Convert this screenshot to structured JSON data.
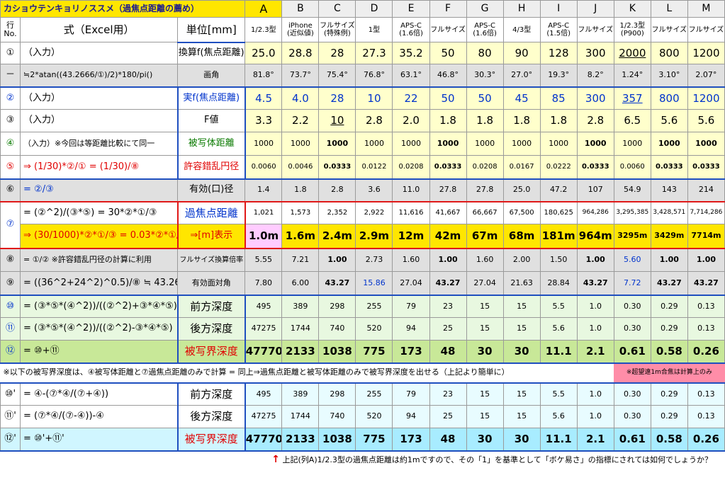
{
  "title": "カショウテンキョリノススメ（過焦点距離の薦め）",
  "columns": [
    "A",
    "B",
    "C",
    "D",
    "E",
    "F",
    "G",
    "H",
    "I",
    "J",
    "K",
    "L",
    "M"
  ],
  "header2": {
    "row_no": "行\nNo.",
    "formula": "式（Excel用）",
    "unit": "単位[mm]",
    "subs": [
      "1/2.3型",
      "iPhone\n(近似値)",
      "フルサイズ\n(特殊例)",
      "1型",
      "APS-C\n(1.6倍)",
      "フルサイズ",
      "APS-C\n(1.6倍)",
      "4/3型",
      "APS-C\n(1.5倍)",
      "フルサイズ",
      "1/2.3型\n(P900)",
      "フルサイズ",
      "フルサイズ"
    ]
  },
  "rows": [
    {
      "idx": "①",
      "formula": "（入力）",
      "unit": "換算f(焦点距離)",
      "values": [
        "25.0",
        "28.8",
        "28",
        "27.3",
        "35.2",
        "50",
        "80",
        "90",
        "128",
        "300",
        "2000",
        "800",
        "1200"
      ]
    },
    {
      "idx": "－",
      "formula": "≒2*atan((43.2666/①)/2)*180/pi()",
      "unit": "画角",
      "values": [
        "81.8°",
        "73.7°",
        "75.4°",
        "76.8°",
        "63.1°",
        "46.8°",
        "30.3°",
        "27.0°",
        "19.3°",
        "8.2°",
        "1.24°",
        "3.10°",
        "2.07°"
      ]
    },
    {
      "idx": "②",
      "formula": "（入力）",
      "unit": "実f(焦点距離)",
      "values": [
        "4.5",
        "4.0",
        "28",
        "10",
        "22",
        "50",
        "50",
        "45",
        "85",
        "300",
        "357",
        "800",
        "1200"
      ]
    },
    {
      "idx": "③",
      "formula": "（入力）",
      "unit": "F値",
      "values": [
        "3.3",
        "2.2",
        "10",
        "2.8",
        "2.0",
        "1.8",
        "1.8",
        "1.8",
        "1.8",
        "2.8",
        "6.5",
        "5.6",
        "5.6"
      ]
    },
    {
      "idx": "④",
      "formula": "（入力）※今回は等距離比較にて同一",
      "unit": "被写体距離",
      "values": [
        "1000",
        "1000",
        "1000",
        "1000",
        "1000",
        "1000",
        "1000",
        "1000",
        "1000",
        "1000",
        "1000",
        "1000",
        "1000"
      ]
    },
    {
      "idx": "⑤",
      "formula": "⇒ (1/30)*②/① = (1/30)/⑧",
      "unit": "許容錯乱円径",
      "values": [
        "0.0060",
        "0.0046",
        "0.0333",
        "0.0122",
        "0.0208",
        "0.0333",
        "0.0208",
        "0.0167",
        "0.0222",
        "0.0333",
        "0.0060",
        "0.0333",
        "0.0333"
      ]
    },
    {
      "idx": "⑥",
      "formula": "= ②/③",
      "unit": "有効(口)径",
      "values": [
        "1.4",
        "1.8",
        "2.8",
        "3.6",
        "11.0",
        "27.8",
        "27.8",
        "25.0",
        "47.2",
        "107",
        "54.9",
        "143",
        "214"
      ]
    },
    {
      "idx": "⑦",
      "formula": "= (②^2)/(③*⑤) = 30*②*①/③",
      "unit": "過焦点距離",
      "values": [
        "1,021",
        "1,573",
        "2,352",
        "2,922",
        "11,616",
        "41,667",
        "66,667",
        "67,500",
        "180,625",
        "964,286",
        "3,295,385",
        "3,428,571",
        "7,714,286"
      ]
    },
    {
      "formula": "⇒ (30/1000)*②*①/③ = 0.03*②*①/③",
      "unit": "⇒[m]表示",
      "values": [
        "1.0m",
        "1.6m",
        "2.4m",
        "2.9m",
        "12m",
        "42m",
        "67m",
        "68m",
        "181m",
        "964m",
        "3295m",
        "3429m",
        "7714m"
      ]
    },
    {
      "idx": "⑧",
      "formula": "= ①/② ※許容錯乱円径の計算に利用",
      "unit": "フルサイズ換算倍率",
      "values": [
        "5.55",
        "7.21",
        "1.00",
        "2.73",
        "1.60",
        "1.00",
        "1.60",
        "2.00",
        "1.50",
        "1.00",
        "5.60",
        "1.00",
        "1.00"
      ]
    },
    {
      "idx": "⑨",
      "formula": "= ((36^2+24^2)^0.5)/⑧ ≒ 43.2666/⑧",
      "unit": "有効面対角",
      "values": [
        "7.80",
        "6.00",
        "43.27",
        "15.86",
        "27.04",
        "43.27",
        "27.04",
        "21.63",
        "28.84",
        "43.27",
        "7.72",
        "43.27",
        "43.27"
      ]
    },
    {
      "idx": "⑩",
      "formula": "= (③*⑤*(④^2))/((②^2)+③*④*⑤)",
      "unit": "前方深度",
      "values": [
        "495",
        "389",
        "298",
        "255",
        "79",
        "23",
        "15",
        "15",
        "5.5",
        "1.0",
        "0.30",
        "0.29",
        "0.13"
      ]
    },
    {
      "idx": "⑪",
      "formula": "= (③*⑤*(④^2))/((②^2)-③*④*⑤)",
      "unit": "後方深度",
      "values": [
        "47275",
        "1744",
        "740",
        "520",
        "94",
        "25",
        "15",
        "15",
        "5.6",
        "1.0",
        "0.30",
        "0.29",
        "0.13"
      ]
    },
    {
      "idx": "⑫",
      "formula": "= ⑩+⑪",
      "unit": "被写界深度",
      "values": [
        "47770",
        "2133",
        "1038",
        "775",
        "173",
        "48",
        "30",
        "30",
        "11.1",
        "2.1",
        "0.61",
        "0.58",
        "0.26"
      ]
    },
    {
      "idx": "⑩'",
      "formula": "= ④-(⑦*④/(⑦+④))",
      "unit": "前方深度",
      "values": [
        "495",
        "389",
        "298",
        "255",
        "79",
        "23",
        "15",
        "15",
        "5.5",
        "1.0",
        "0.30",
        "0.29",
        "0.13"
      ]
    },
    {
      "idx": "⑪'",
      "formula": "= (⑦*④/(⑦-④))-④",
      "unit": "後方深度",
      "values": [
        "47275",
        "1744",
        "740",
        "520",
        "94",
        "25",
        "15",
        "15",
        "5.6",
        "1.0",
        "0.30",
        "0.29",
        "0.13"
      ]
    },
    {
      "idx": "⑫'",
      "formula": "= ⑩'+⑪'",
      "unit": "被写界深度",
      "values": [
        "47770",
        "2133",
        "1038",
        "775",
        "173",
        "48",
        "30",
        "30",
        "11.1",
        "2.1",
        "0.61",
        "0.58",
        "0.26"
      ]
    }
  ],
  "note": "※以下の被写界深度は、④被写体距離と⑦過焦点距離のみで計算 = 同上⇒過焦点距離と被写体距離のみで被写界深度を出せる（上記より簡単に）",
  "note_right": "※超望遠1m合焦は計算上のみ",
  "footer_arrow": "↑",
  "footer": "上記(列A)1/2.3型の過焦点距離は約1mですので、その「1」を基準として「ボケ易さ」の指標にされては如何でしょうか？",
  "colors": {
    "yellow": "#ffe600",
    "blue_border": "#1f4fbf",
    "red_border": "#e01818",
    "green": "#0a7a00",
    "red": "#e00000",
    "blue": "#0033cc"
  }
}
